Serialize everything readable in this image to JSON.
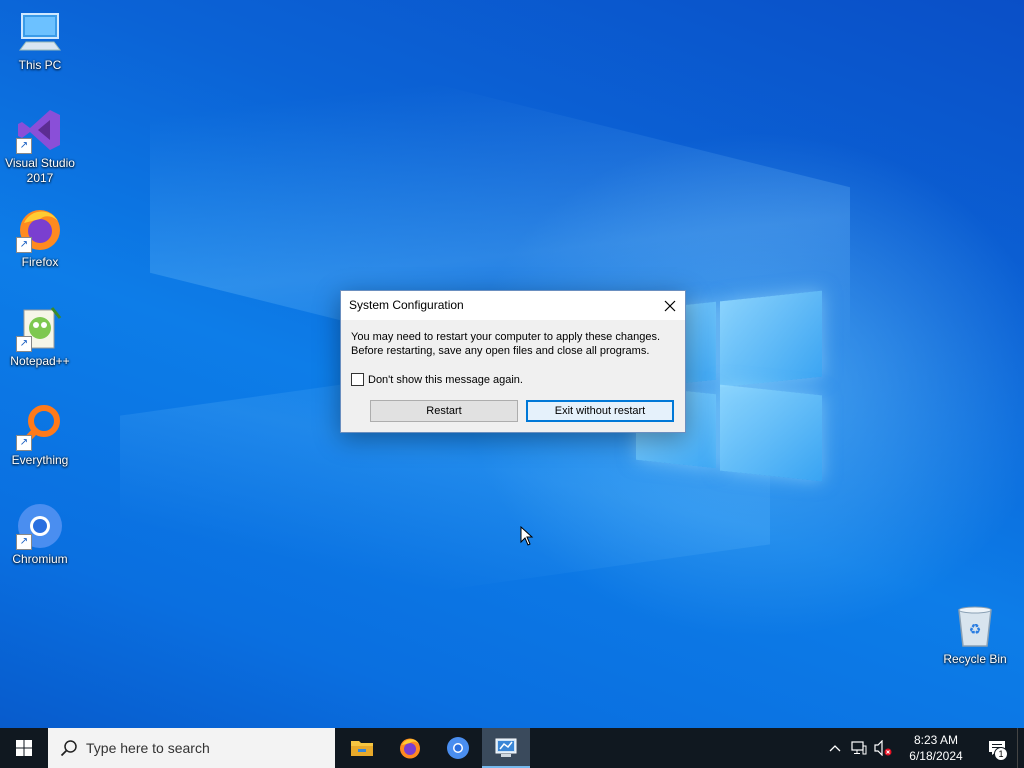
{
  "desktop": {
    "icons": [
      {
        "label": "This PC"
      },
      {
        "label": "Visual Studio 2017"
      },
      {
        "label": "Firefox"
      },
      {
        "label": "Notepad++"
      },
      {
        "label": "Everything"
      },
      {
        "label": "Chromium"
      },
      {
        "label": "Recycle Bin"
      }
    ]
  },
  "dialog": {
    "title": "System Configuration",
    "message_line1": "You may need to restart your computer to apply these changes.",
    "message_line2": "Before restarting, save any open files and close all programs.",
    "checkbox_label": "Don't show this message again.",
    "checkbox_checked": false,
    "restart_label": "Restart",
    "exit_label": "Exit without restart"
  },
  "taskbar": {
    "search_placeholder": "Type here to search",
    "apps": [
      "file-explorer",
      "firefox",
      "chromium",
      "system-configuration"
    ],
    "time": "8:23 AM",
    "date": "6/18/2024",
    "notification_count": "1"
  },
  "colors": {
    "accent": "#0078d7",
    "taskbar": "#101820"
  }
}
